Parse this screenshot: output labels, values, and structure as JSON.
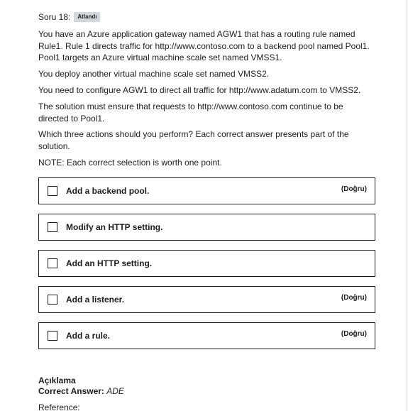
{
  "question": {
    "label": "Soru 18:",
    "badge": "Atlandı",
    "paragraphs": [
      "You have an Azure application gateway named AGW1 that has a routing rule named Rule1. Rule 1 directs traffic for http://www.contoso.com to a backend pool named Pool1. Pool1 targets an Azure virtual machine scale set named VMSS1.",
      "You deploy another virtual machine scale set named VMSS2.",
      "You need to configure AGW1 to direct all traffic for http://www.adatum.com to VMSS2.",
      "The solution must ensure that requests to http://www.contoso.com continue to be directed to Pool1.",
      "Which three actions should you perform? Each correct answer presents part of the solution.",
      "NOTE: Each correct selection is worth one point."
    ]
  },
  "options": [
    {
      "label": "Add a backend pool.",
      "status": "(Doğru)"
    },
    {
      "label": "Modify an HTTP setting.",
      "status": ""
    },
    {
      "label": "Add an HTTP setting.",
      "status": ""
    },
    {
      "label": "Add a listener.",
      "status": "(Doğru)"
    },
    {
      "label": "Add a rule.",
      "status": "(Doğru)"
    }
  ],
  "explanation": {
    "title": "Açıklama",
    "answer_label": "Correct Answer:",
    "answer_value": "ADE",
    "reference_label": "Reference:"
  }
}
